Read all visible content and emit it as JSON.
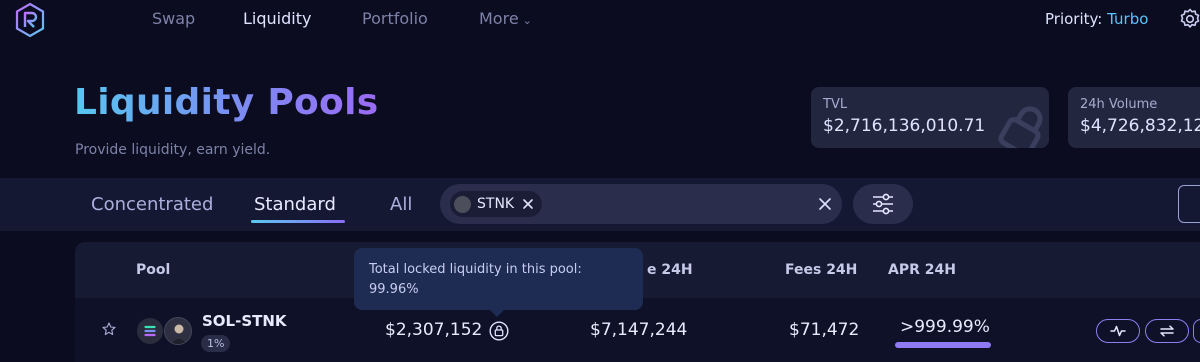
{
  "nav": {
    "items": [
      {
        "label": "Swap"
      },
      {
        "label": "Liquidity"
      },
      {
        "label": "Portfolio"
      },
      {
        "label": "More"
      }
    ],
    "priority_label": "Priority:",
    "priority_value": "Turbo"
  },
  "header": {
    "title": "Liquidity Pools",
    "subtitle": "Provide liquidity, earn yield."
  },
  "stats": {
    "tvl": {
      "label": "TVL",
      "value": "$2,716,136,010.71"
    },
    "volume": {
      "label": "24h Volume",
      "value": "$4,726,832,12"
    }
  },
  "filters": {
    "tabs": [
      {
        "label": "Concentrated"
      },
      {
        "label": "Standard"
      },
      {
        "label": "All"
      }
    ],
    "active_tab": "Standard",
    "search_chip": "STNK"
  },
  "table": {
    "columns": {
      "pool": "Pool",
      "volume_partial": "e 24H",
      "fees": "Fees 24H",
      "apr": "APR 24H"
    },
    "rows": [
      {
        "pool": "SOL-STNK",
        "fee_tier": "1%",
        "liquidity": "$2,307,152",
        "volume": "$7,147,244",
        "fees": "$71,472",
        "apr": ">999.99%"
      }
    ]
  },
  "tooltip": {
    "line1": "Total locked liquidity in this pool:",
    "line2": "99.96%"
  },
  "colors": {
    "background": "#0b0c1f",
    "accent_purple": "#8f7af4",
    "accent_blue": "#5fc2ff"
  }
}
